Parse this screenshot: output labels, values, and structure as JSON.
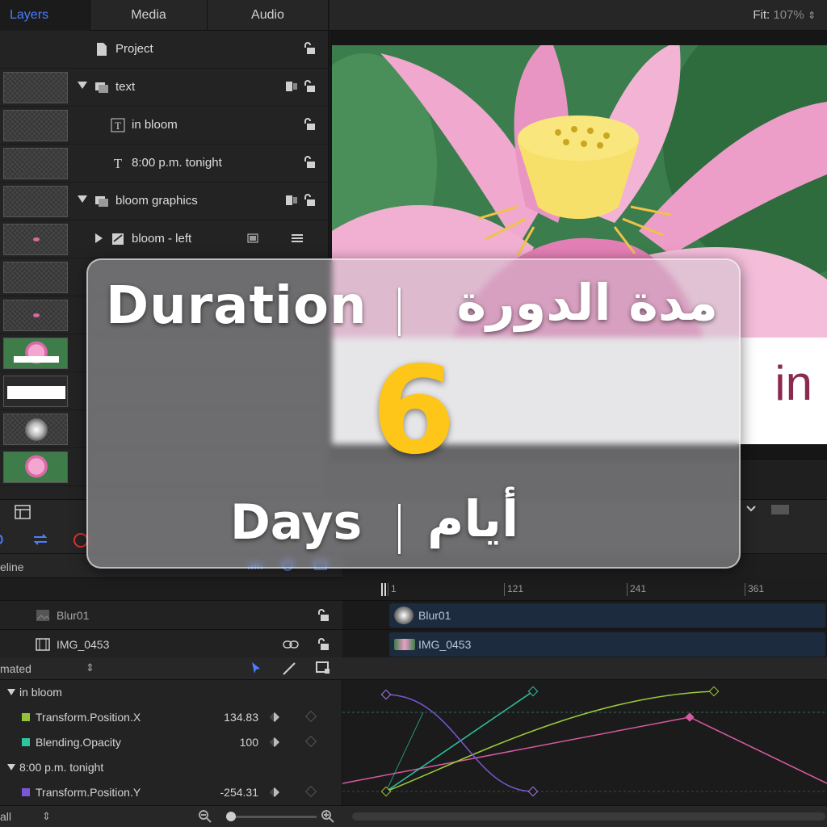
{
  "tabs": [
    {
      "label": "Layers",
      "active": true
    },
    {
      "label": "Media",
      "active": false
    },
    {
      "label": "Audio",
      "active": false
    }
  ],
  "fit": {
    "label": "Fit:",
    "value": "107%"
  },
  "layers": [
    {
      "name": "Project",
      "icon": "document-icon"
    },
    {
      "name": "text",
      "icon": "group-icon",
      "expanded": true
    },
    {
      "name": "in bloom",
      "icon": "text-layer-icon"
    },
    {
      "name": "8:00 p.m. tonight",
      "icon": "text-layer-icon"
    },
    {
      "name": "bloom graphics",
      "icon": "group-icon",
      "expanded": true
    },
    {
      "name": "bloom - left",
      "icon": "replicator-icon",
      "expanded": false
    }
  ],
  "canvas": {
    "word": "in"
  },
  "timeline": {
    "label": "eline",
    "ruler_ticks": [
      "1",
      "121",
      "241",
      "361"
    ],
    "tracks": [
      {
        "name": "Blur01",
        "clip": "Blur01"
      },
      {
        "name": "IMG_0453",
        "clip": "IMG_0453"
      }
    ]
  },
  "keyframes": {
    "filter": "mated",
    "groups": [
      {
        "name": "in bloom",
        "params": [
          {
            "name": "Transform.Position.X",
            "value": "134.83",
            "color": "#8fc43a"
          },
          {
            "name": "Blending.Opacity",
            "value": "100",
            "color": "#2ec4a0"
          }
        ]
      },
      {
        "name": "8:00 p.m. tonight",
        "params": [
          {
            "name": "Transform.Position.Y",
            "value": "-254.31",
            "color": "#7a57d6"
          }
        ]
      }
    ],
    "bottom_filter": "all"
  },
  "overlay": {
    "title_en": "Duration",
    "title_ar": "مدة الدورة",
    "number": "6",
    "unit_en": "Days",
    "unit_ar": "أيام",
    "number_color": "#ffc61a"
  }
}
